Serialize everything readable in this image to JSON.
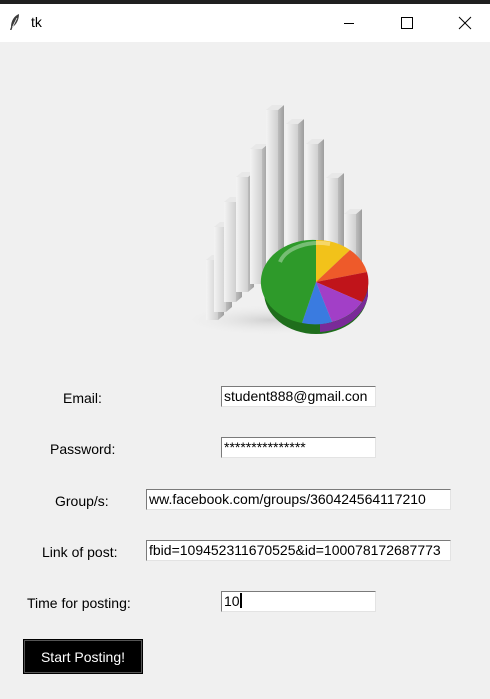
{
  "window": {
    "title": "tk",
    "icons": [
      "feather-icon",
      "minimize-icon",
      "maximize-icon",
      "close-icon"
    ]
  },
  "logo": {
    "icon": "bar-chart-pie-chart-image",
    "colors": {
      "pie_green": "#2e9a2a",
      "pie_yellow": "#f2c21a",
      "pie_orange": "#ee5a2a",
      "pie_red": "#c0141a",
      "pie_purple": "#a23fc7",
      "pie_blue": "#3a7be0",
      "bars": "#d4d4d4"
    }
  },
  "form": {
    "email": {
      "label": "Email:",
      "value": "student888@gmail.con"
    },
    "password": {
      "label": "Password:",
      "value": "***************"
    },
    "groups": {
      "label": "Group/s:",
      "value": "ww.facebook.com/groups/360424564117210"
    },
    "link": {
      "label": "Link of post:",
      "value": "fbid=109452311670525&id=100078172687773"
    },
    "time": {
      "label": "Time for posting:",
      "value": "10"
    },
    "start_button": "Start Posting!"
  }
}
